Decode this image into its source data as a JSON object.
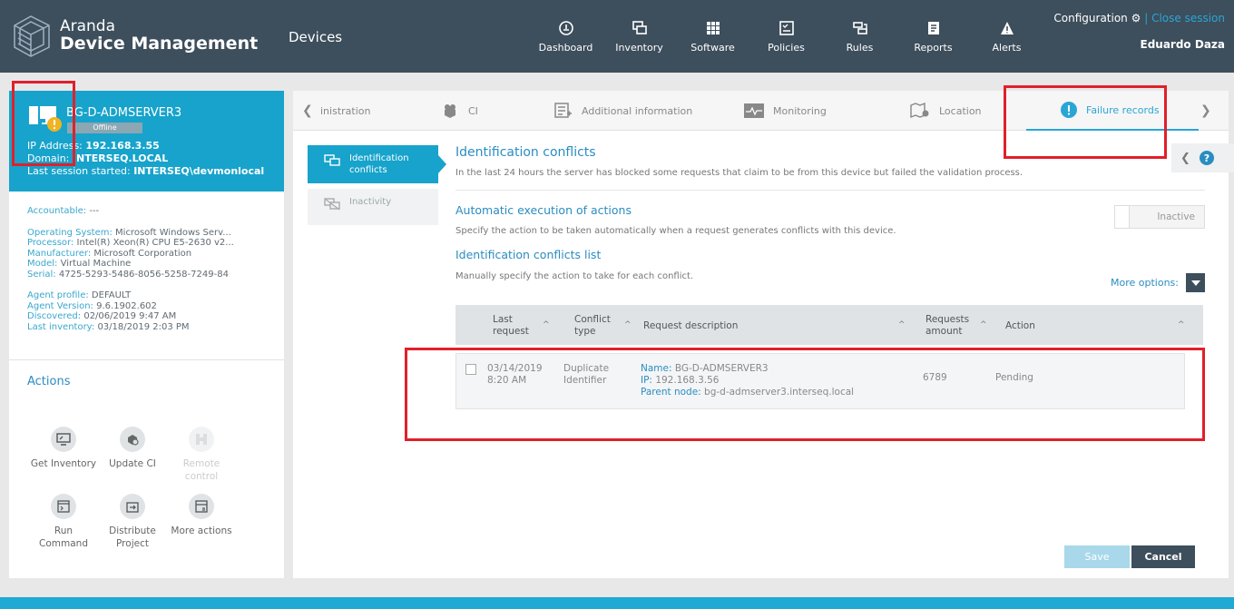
{
  "brand": {
    "name": "Aranda",
    "product": "Device Management"
  },
  "header": {
    "module_title": "Devices",
    "nav": [
      {
        "label": "Dashboard",
        "icon": "dashboard-icon"
      },
      {
        "label": "Inventory",
        "icon": "inventory-icon"
      },
      {
        "label": "Software",
        "icon": "software-icon"
      },
      {
        "label": "Policies",
        "icon": "policies-icon"
      },
      {
        "label": "Rules",
        "icon": "rules-icon"
      },
      {
        "label": "Reports",
        "icon": "reports-icon"
      },
      {
        "label": "Alerts",
        "icon": "alerts-icon"
      }
    ],
    "configuration": "Configuration",
    "close_session": "| Close session",
    "user": "Eduardo Daza"
  },
  "device": {
    "name": "BG-D-ADMSERVER3",
    "status": "Offline",
    "ip_label": "IP Address:",
    "ip": "192.168.3.55",
    "domain_label": "Domain:",
    "domain": "INTERSEQ.LOCAL",
    "last_session_label": "Last session started:",
    "last_session": "INTERSEQ\\devmonlocal"
  },
  "properties": {
    "accountable": {
      "label": "Accountable:",
      "value": "---"
    },
    "os": {
      "label": "Operating System:",
      "value": "Microsoft Windows Serv..."
    },
    "processor": {
      "label": "Processor:",
      "value": "Intel(R) Xeon(R) CPU E5-2630 v2..."
    },
    "manufacturer": {
      "label": "Manufacturer:",
      "value": "Microsoft Corporation"
    },
    "model": {
      "label": "Model:",
      "value": "Virtual Machine"
    },
    "serial": {
      "label": "Serial:",
      "value": "4725-5293-5486-8056-5258-7249-84"
    },
    "agent_profile": {
      "label": "Agent profile:",
      "value": "DEFAULT"
    },
    "agent_version": {
      "label": "Agent Version:",
      "value": "9.6.1902.602"
    },
    "discovered": {
      "label": "Discovered:",
      "value": "02/06/2019 9:47 AM"
    },
    "last_inventory": {
      "label": "Last inventory:",
      "value": "03/18/2019 2:03 PM"
    }
  },
  "actions": {
    "title": "Actions",
    "items": [
      {
        "label": "Get Inventory",
        "icon": "get-inventory-icon",
        "enabled": true
      },
      {
        "label": "Update CI",
        "icon": "update-ci-icon",
        "enabled": true
      },
      {
        "label": "Remote control",
        "icon": "remote-control-icon",
        "enabled": false
      },
      {
        "label": "Run Command",
        "icon": "run-command-icon",
        "enabled": true
      },
      {
        "label": "Distribute Project",
        "icon": "distribute-project-icon",
        "enabled": true
      },
      {
        "label": "More actions",
        "icon": "more-actions-icon",
        "enabled": true
      }
    ]
  },
  "tabs": {
    "administration": "inistration",
    "ci": "CI",
    "additional": "Additional information",
    "monitoring": "Monitoring",
    "location": "Location",
    "failure": "Failure records"
  },
  "subnav": {
    "identification": "Identification conflicts",
    "inactivity": "Inactivity"
  },
  "content": {
    "title": "Identification conflicts",
    "description": "In the last 24 hours the server has blocked some requests that claim to be from this device but failed the validation process.",
    "auto_title": "Automatic execution of actions",
    "auto_desc": "Specify the action to be taken automatically when a request generates conflicts with this device.",
    "toggle_state": "Inactive",
    "list_title": "Identification conflicts list",
    "list_desc": "Manually specify the action to take for each conflict.",
    "more_options": "More options:"
  },
  "grid": {
    "columns": {
      "last_request": "Last request",
      "conflict_type": "Conflict type",
      "request_description": "Request description",
      "requests_amount": "Requests amount",
      "action": "Action"
    },
    "rows": [
      {
        "date": "03/14/2019",
        "time": "8:20 AM",
        "conflict_line1": "Duplicate",
        "conflict_line2": "Identifier",
        "name_label": "Name:",
        "name": "BG-D-ADMSERVER3",
        "ip_label": "IP:",
        "ip": "192.168.3.56",
        "parent_label": "Parent node:",
        "parent": "bg-d-admserver3.interseq.local",
        "amount": "6789",
        "action": "Pending"
      }
    ]
  },
  "buttons": {
    "save": "Save",
    "cancel": "Cancel"
  },
  "colors": {
    "accent": "#17a3cb",
    "header": "#3d4e5c",
    "annotation": "#e0202a"
  }
}
